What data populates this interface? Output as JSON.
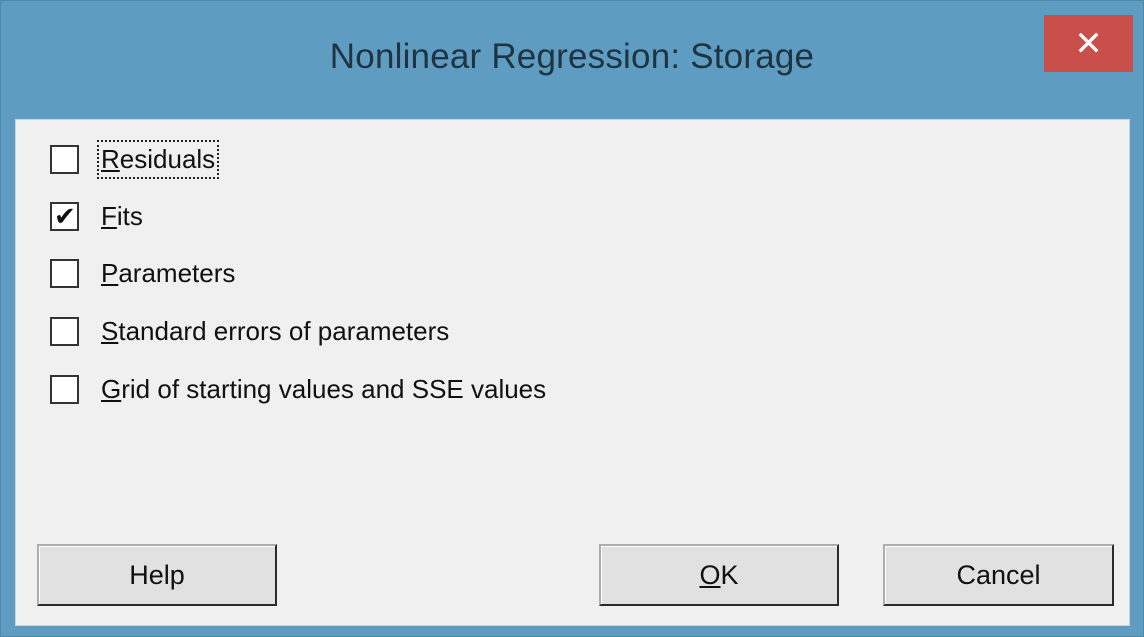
{
  "window": {
    "title": "Nonlinear Regression: Storage",
    "close_glyph": "✕"
  },
  "options": [
    {
      "mnemonic": "R",
      "rest": "esiduals",
      "checked": false,
      "focused": true
    },
    {
      "mnemonic": "F",
      "rest": "its",
      "checked": true,
      "focused": false
    },
    {
      "mnemonic": "P",
      "rest": "arameters",
      "checked": false,
      "focused": false
    },
    {
      "mnemonic": "S",
      "rest": "tandard errors of parameters",
      "checked": false,
      "focused": false
    },
    {
      "mnemonic": "G",
      "rest": "rid of starting values and SSE values",
      "checked": false,
      "focused": false
    }
  ],
  "check_glyph": "✔",
  "buttons": {
    "help": "Help",
    "ok_mnemonic": "O",
    "ok_rest": "K",
    "cancel": "Cancel"
  },
  "colors": {
    "title_bar": "#5e9dc1",
    "close": "#c9504a",
    "client": "#f0f0f0"
  }
}
